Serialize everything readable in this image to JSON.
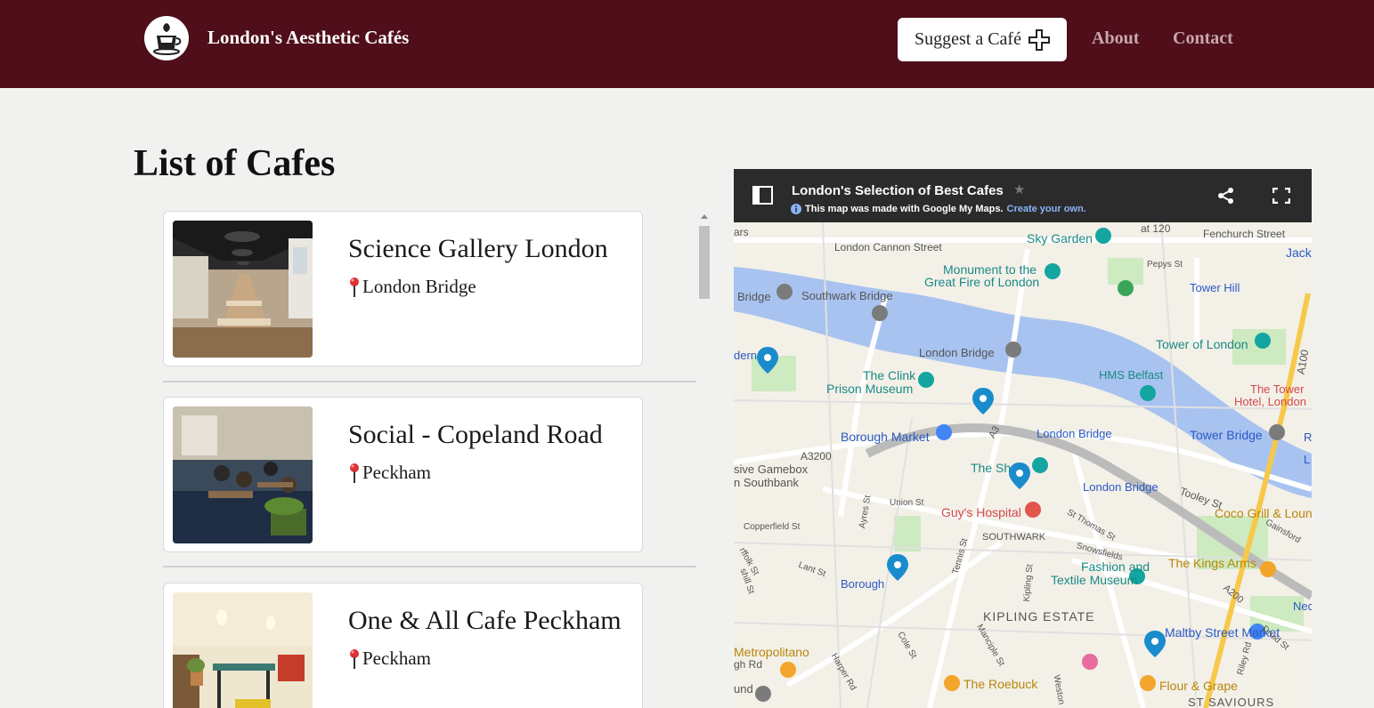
{
  "header": {
    "title": "London's Aesthetic Cafés",
    "suggest_label": "Suggest a Café",
    "nav": {
      "about": "About",
      "contact": "Contact"
    },
    "bg_color": "#4f0e1a"
  },
  "list": {
    "title": "List of Cafes",
    "cafes": [
      {
        "name": "Science Gallery London",
        "location": "London Bridge"
      },
      {
        "name": "Social - Copeland Road",
        "location": "Peckham"
      },
      {
        "name": "One & All Cafe Peckham",
        "location": "Peckham"
      }
    ]
  },
  "map": {
    "title": "London's Selection of Best Cafes",
    "note": "This map was made with Google My Maps.",
    "note_link": "Create your own.",
    "labels": {
      "cannon_street": "London Cannon Street",
      "sky_garden": "Sky Garden",
      "at120": "at 120",
      "fenchurch": "Fenchurch Street",
      "monument": "Monument to the",
      "great_fire": "Great Fire of London",
      "pepys": "Pepys St",
      "tower_hill": "Tower Hill",
      "jack": "Jack",
      "bridge": "Bridge",
      "southwark_bridge": "Southwark Bridge",
      "tower_of_london": "Tower of London",
      "london_bridge_top": "London Bridge",
      "hms_belfast": "HMS Belfast",
      "the_clink": "The Clink",
      "prison_museum": "Prison Museum",
      "the_tower_hotel_1": "The Tower",
      "the_tower_hotel_2": "Hotel, London",
      "borough_market": "Borough Market",
      "london_bridge_station": "London Bridge",
      "tower_bridge": "Tower Bridge",
      "a3200": "A3200",
      "the_shard": "The Sh",
      "gamebox_1": "sive Gamebox",
      "gamebox_2": "n Southbank",
      "london_bridge_rail": "London Bridge",
      "tooley": "Tooley St",
      "coco_grill": "Coco Grill & Loun",
      "union_st": "Union St",
      "guys": "Guy's Hospital",
      "copperfield": "Copperfield St",
      "southwark": "SOUTHWARK",
      "st_thomas": "St Thomas St",
      "fashion_1": "Fashion and",
      "fashion_2": "Textile Museum",
      "kings_arms": "The Kings Arms",
      "borough": "Borough",
      "kipling": "KIPLING ESTATE",
      "maltby": "Maltby Street Market",
      "metropolitano": "Metropolitano",
      "roebuck": "The Roebuck",
      "flour_grape": "Flour & Grape",
      "st_saviours": "ST SAVIOURS",
      "a100": "A100",
      "a200": "A200",
      "a3": "A3",
      "ayres": "Ayres St",
      "snowsfields": "Snowsfields",
      "lant": "Lant St",
      "kipling_st": "Kipling St",
      "tennis": "Tennis St",
      "gainsford": "Gainsford",
      "druid": "Druid St",
      "riley": "Riley Rd",
      "cole": "Cole St",
      "manciple": "Manciple St",
      "harper": "Harper Rd",
      "weston": "Weston",
      "gh_rd": "gh Rd",
      "rffolk": "rffolk St",
      "shill": "shill St",
      "ars": "ars",
      "dern": "dern",
      "nec": "Nec",
      "und": "und",
      "r_edge": "R",
      "l_edge": "L"
    },
    "colors": {
      "river": "#a8c3f0",
      "land": "#f3f0e8",
      "road": "#ffffff",
      "park": "#cdeac0",
      "pin": "#1a8ccc"
    }
  }
}
